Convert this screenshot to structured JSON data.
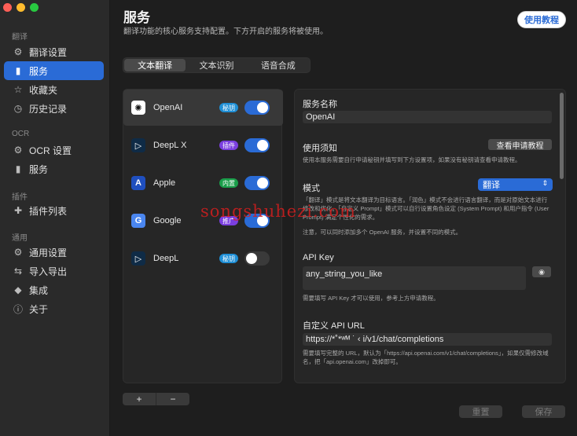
{
  "window_controls": [
    "close",
    "minimize",
    "zoom"
  ],
  "sidebar": {
    "sections": [
      {
        "title": "翻译",
        "items": [
          {
            "label": "翻译设置",
            "icon": "gear-icon"
          },
          {
            "label": "服务",
            "icon": "bookmark-icon",
            "active": true
          },
          {
            "label": "收藏夹",
            "icon": "star-icon"
          },
          {
            "label": "历史记录",
            "icon": "clock-icon"
          }
        ]
      },
      {
        "title": "OCR",
        "items": [
          {
            "label": "OCR 设置",
            "icon": "gear-icon"
          },
          {
            "label": "服务",
            "icon": "bookmark-icon"
          }
        ]
      },
      {
        "title": "插件",
        "items": [
          {
            "label": "插件列表",
            "icon": "puzzle-icon"
          }
        ]
      },
      {
        "title": "通用",
        "items": [
          {
            "label": "通用设置",
            "icon": "gear-icon"
          },
          {
            "label": "导入导出",
            "icon": "import-export-icon"
          },
          {
            "label": "集成",
            "icon": "plug-icon"
          },
          {
            "label": "关于",
            "icon": "info-icon"
          }
        ]
      }
    ]
  },
  "header": {
    "title": "服务",
    "subtitle": "翻译功能的核心服务支持配置。下方开启的服务将被使用。",
    "tutorial_button": "使用教程"
  },
  "tabs": [
    {
      "label": "文本翻译",
      "active": true
    },
    {
      "label": "文本识别",
      "active": false
    },
    {
      "label": "语音合成",
      "active": false
    }
  ],
  "services": [
    {
      "name": "OpenAI",
      "badge": "秘钥",
      "badge_color": "#1f8fd6",
      "enabled": true,
      "selected": true,
      "icon_bg": "#ffffff",
      "icon_fg": "#111111",
      "icon_glyph": "✺"
    },
    {
      "name": "DeepL X",
      "badge": "插件",
      "badge_color": "#7b3fe0",
      "enabled": true,
      "selected": false,
      "icon_bg": "#0f2b46",
      "icon_fg": "#ffffff",
      "icon_glyph": "▷"
    },
    {
      "name": "Apple",
      "badge": "内置",
      "badge_color": "#1a9e4a",
      "enabled": true,
      "selected": false,
      "icon_bg": "#1f4fbf",
      "icon_fg": "#ffffff",
      "icon_glyph": "A"
    },
    {
      "name": "Google",
      "badge": "推广",
      "badge_color": "#7b3fe0",
      "enabled": true,
      "selected": false,
      "icon_bg": "#4a86f0",
      "icon_fg": "#ffffff",
      "icon_glyph": "G"
    },
    {
      "name": "DeepL",
      "badge": "秘钥",
      "badge_color": "#1f8fd6",
      "enabled": false,
      "selected": false,
      "icon_bg": "#0f2b46",
      "icon_fg": "#ffffff",
      "icon_glyph": "▷"
    }
  ],
  "list_controls": {
    "add": "+",
    "remove": "−"
  },
  "detail": {
    "name_label": "服务名称",
    "name_value": "OpenAI",
    "usage_label": "使用须知",
    "usage_button": "查看申请教程",
    "usage_note": "使用本服务需要自行申请秘钥并填写到下方设置项，如果没有秘钥请查看申请教程。",
    "mode_label": "模式",
    "mode_value": "翻译",
    "mode_note_1": "「翻译」模式是将文本翻译为目标语言。「润色」模式不会进行语言翻译，而是对原始文本进行修改和优化。「自定义 Prompt」模式可以自行设置角色设定 (System Prompt) 和用户指令 (User Prompt) 满足个性化的需求。",
    "mode_note_2": "注意，可以同时添加多个 OpenAI 服务，并设置不同的模式。",
    "apikey_label": "API Key",
    "apikey_value": "any_string_you_like",
    "apikey_note": "需要填写 API Key 才可以使用，参考上方申请教程。",
    "url_label": "自定义 API URL",
    "url_value": "https://*˚*ʷᴹ   ˙ ‹ i/v1/chat/completions",
    "url_note": "需要填写完整的 URL，默认为「https://api.openai.com/v1/chat/completions」，如果仅需修改域名，把「api.openai.com」改掉即可。"
  },
  "footer": {
    "reset": "重置",
    "save": "保存"
  },
  "watermark": "songshuhezi.com"
}
